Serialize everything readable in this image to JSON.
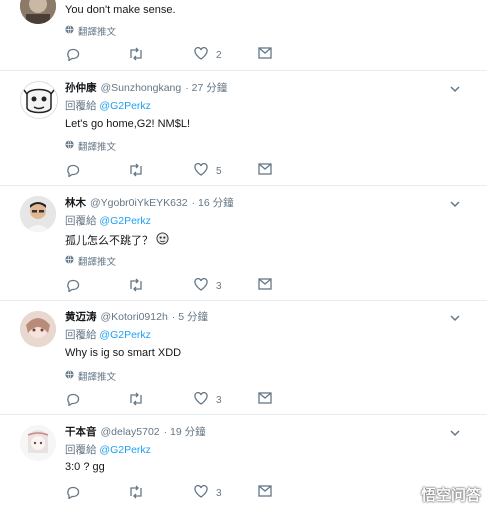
{
  "ui": {
    "translate_label": "翻譯推文",
    "reply_prefix": "回覆給"
  },
  "tweets": [
    {
      "display_name": "",
      "handle": "",
      "time": "",
      "reply_to": "",
      "text": "You don't make sense.",
      "likes": "2"
    },
    {
      "display_name": "孙仲康",
      "handle": "@Sunzhongkang",
      "time": "· 27 分鐘",
      "reply_to": "@G2Perkz",
      "text": "Let's go home,G2! NM$L!",
      "likes": "5"
    },
    {
      "display_name": "林木",
      "handle": "@Ygobr0iYkEYK632",
      "time": "· 16 分鐘",
      "reply_to": "@G2Perkz",
      "text": "孤儿怎么不跳了？",
      "likes": "3"
    },
    {
      "display_name": "黄迈涛",
      "handle": "@Kotori0912h",
      "time": "· 5 分鐘",
      "reply_to": "@G2Perkz",
      "text": "Why is ig so smart XDD",
      "likes": "3"
    },
    {
      "display_name": "干本音",
      "handle": "@delay5702",
      "time": "· 19 分鐘",
      "reply_to": "@G2Perkz",
      "text": "3:0 ? gg",
      "likes": "3"
    }
  ],
  "watermark": {
    "text": "悟空问答"
  },
  "colors": {
    "link": "#1da1f2",
    "meta": "#657786",
    "divider": "#e6ecf0"
  },
  "icons": [
    "reply-icon",
    "retweet-icon",
    "like-icon",
    "message-icon",
    "translate-globe-icon",
    "chevron-down-icon",
    "emoji-icon"
  ]
}
